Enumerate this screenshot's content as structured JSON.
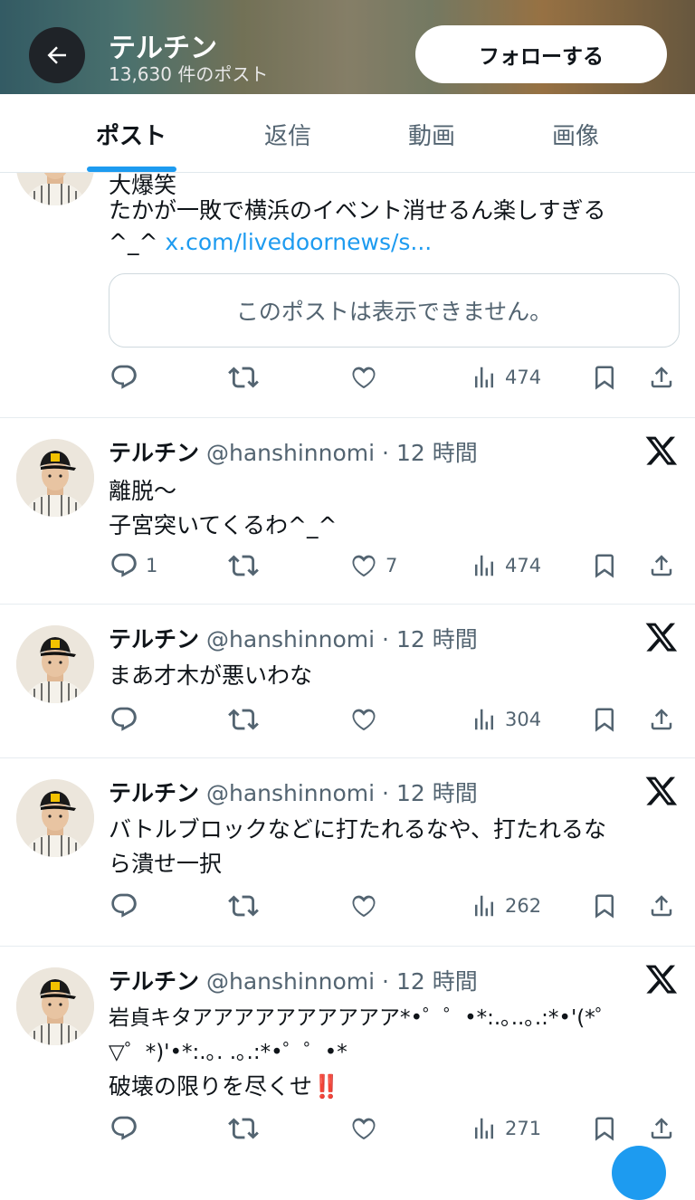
{
  "header": {
    "title": "テルチン",
    "subtitle": "13,630 件のポスト",
    "follow_label": "フォローする"
  },
  "tabs": [
    "ポスト",
    "返信",
    "動画",
    "画像"
  ],
  "posts": [
    {
      "partial_line": "大爆笑",
      "lines": [
        "たかが一敗で横浜のイベント消せるん楽しすぎる"
      ],
      "prefix_last": "^_^ ",
      "link": "x.com/livedoornews/s...",
      "quote": "このポストは表示できません。",
      "stats": {
        "replies": "",
        "likes": "",
        "views": "474"
      }
    },
    {
      "name": "テルチン",
      "handle": "@hanshinnomi",
      "dot": "·",
      "time": "12 時間",
      "lines": [
        "離脱〜",
        "子宮突いてくるわ^_^"
      ],
      "stats": {
        "replies": "1",
        "likes": "7",
        "views": "474"
      }
    },
    {
      "name": "テルチン",
      "handle": "@hanshinnomi",
      "dot": "·",
      "time": "12 時間",
      "lines": [
        "まあ才木が悪いわな"
      ],
      "stats": {
        "replies": "",
        "likes": "",
        "views": "304"
      }
    },
    {
      "name": "テルチン",
      "handle": "@hanshinnomi",
      "dot": "·",
      "time": "12 時間",
      "lines": [
        "バトルブロックなどに打たれるなや、打たれるな",
        "ら潰せ一択"
      ],
      "stats": {
        "replies": "",
        "likes": "",
        "views": "262"
      }
    },
    {
      "name": "テルチン",
      "handle": "@hanshinnomi",
      "dot": "·",
      "time": "12 時間",
      "lines": [
        "岩貞キタアアアアアアアアアア*•゜゜•*:.｡..｡.:*•'(*゜",
        "▽゜*)'•*:.｡. .｡.:*•゜゜•*",
        "破壊の限りを尽くせ‼️"
      ],
      "stats": {
        "replies": "",
        "likes": "",
        "views": "271"
      }
    }
  ]
}
